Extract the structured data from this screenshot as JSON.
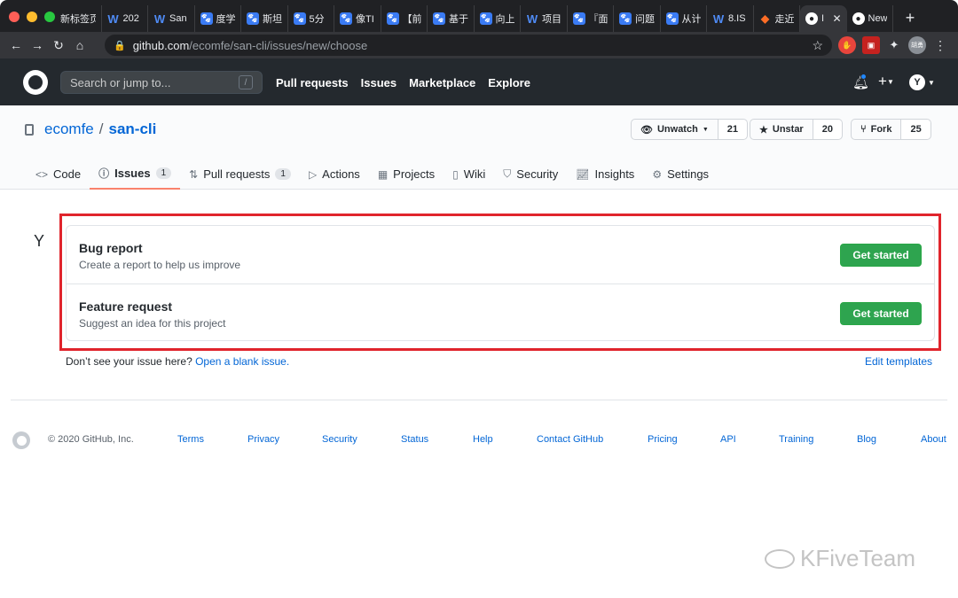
{
  "browser": {
    "tabs": [
      {
        "label": "新标签页",
        "icon": "none"
      },
      {
        "label": "202",
        "icon": "word-icon"
      },
      {
        "label": "San",
        "icon": "word-icon"
      },
      {
        "label": "度学",
        "icon": "baidu-paw-icon"
      },
      {
        "label": "斯坦",
        "icon": "baidu-paw-icon"
      },
      {
        "label": "5分",
        "icon": "baidu-paw-icon"
      },
      {
        "label": "像TI",
        "icon": "baidu-paw-icon"
      },
      {
        "label": "【前",
        "icon": "baidu-paw-icon"
      },
      {
        "label": "基于",
        "icon": "baidu-paw-icon"
      },
      {
        "label": "向上",
        "icon": "baidu-paw-icon"
      },
      {
        "label": "项目",
        "icon": "word-icon"
      },
      {
        "label": "『面",
        "icon": "baidu-paw-icon"
      },
      {
        "label": "问题",
        "icon": "baidu-paw-icon"
      },
      {
        "label": "从计",
        "icon": "baidu-paw-icon"
      },
      {
        "label": "8.IS",
        "icon": "word-icon"
      },
      {
        "label": "走近",
        "icon": "gitlab-icon"
      },
      {
        "label": "I",
        "icon": "github-icon",
        "active": true
      },
      {
        "label": "New",
        "icon": "github-icon"
      }
    ],
    "url_host": "github.com",
    "url_path": "/ecomfe/san-cli/issues/new/choose",
    "profile_label": "胡勇"
  },
  "header": {
    "search_placeholder": "Search or jump to...",
    "search_shortcut": "/",
    "nav": [
      "Pull requests",
      "Issues",
      "Marketplace",
      "Explore"
    ],
    "avatar_initial": "Y"
  },
  "repo": {
    "owner": "ecomfe",
    "separator": "/",
    "name": "san-cli",
    "unwatch_label": "Unwatch",
    "watch_count": "21",
    "unstar_label": "Unstar",
    "star_count": "20",
    "fork_label": "Fork",
    "fork_count": "25"
  },
  "tabs": [
    {
      "label": "Code",
      "icon": "code-icon"
    },
    {
      "label": "Issues",
      "icon": "issue-icon",
      "count": "1",
      "selected": true
    },
    {
      "label": "Pull requests",
      "icon": "pull-request-icon",
      "count": "1"
    },
    {
      "label": "Actions",
      "icon": "play-icon"
    },
    {
      "label": "Projects",
      "icon": "project-icon"
    },
    {
      "label": "Wiki",
      "icon": "book-icon"
    },
    {
      "label": "Security",
      "icon": "shield-icon"
    },
    {
      "label": "Insights",
      "icon": "graph-icon"
    },
    {
      "label": "Settings",
      "icon": "gear-icon"
    }
  ],
  "page": {
    "avatar_letter": "Y",
    "templates": [
      {
        "name": "Bug report",
        "description": "Create a report to help us improve",
        "button": "Get started"
      },
      {
        "name": "Feature request",
        "description": "Suggest an idea for this project",
        "button": "Get started"
      }
    ],
    "blank_prompt": "Don’t see your issue here?",
    "blank_link": "Open a blank issue.",
    "edit_templates": "Edit templates"
  },
  "footer": {
    "copyright": "© 2020 GitHub, Inc.",
    "links": [
      "Terms",
      "Privacy",
      "Security",
      "Status",
      "Help",
      "Contact GitHub",
      "Pricing",
      "API",
      "Training",
      "Blog",
      "About"
    ]
  },
  "watermark": "KFiveTeam",
  "colors": {
    "accent": "#0366d6",
    "success": "#2ea44f",
    "highlight": "#e0242c",
    "tab_underline": "#f9826c"
  }
}
